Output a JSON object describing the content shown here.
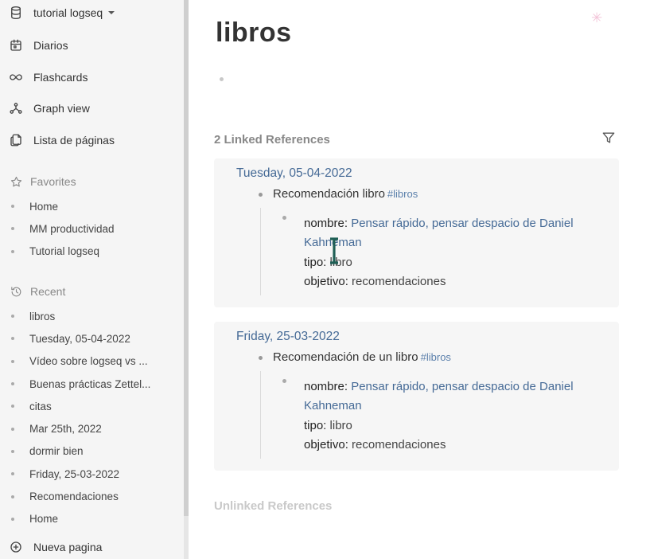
{
  "sidebar": {
    "graph_name": "tutorial logseq",
    "nav": [
      {
        "label": "Diarios",
        "icon": "calendar-icon"
      },
      {
        "label": "Flashcards",
        "icon": "infinity-icon"
      },
      {
        "label": "Graph view",
        "icon": "graph-icon"
      },
      {
        "label": "Lista de páginas",
        "icon": "pages-icon"
      }
    ],
    "favorites": {
      "title": "Favorites",
      "items": [
        "Home",
        "MM productividad",
        "Tutorial logseq"
      ]
    },
    "recent": {
      "title": "Recent",
      "items": [
        "libros",
        "Tuesday, 05-04-2022",
        "Vídeo sobre logseq vs ...",
        "Buenas prácticas Zettel...",
        "citas",
        "Mar 25th, 2022",
        "dormir bien",
        "Friday, 25-03-2022",
        "Recomendaciones",
        "Home"
      ]
    },
    "new_page": "Nueva pagina"
  },
  "page": {
    "title": "libros",
    "linked_title": "2 Linked References",
    "unlinked_title": "Unlinked References",
    "refs": [
      {
        "date": "Tuesday, 05-04-2022",
        "block": "Recomendación libro",
        "tag": "#libros",
        "props": {
          "nombre_key": "nombre:",
          "nombre_val": "Pensar rápido, pensar despacio de Daniel Kahneman",
          "tipo_key": "tipo:",
          "tipo_val": "libro",
          "objetivo_key": "objetivo:",
          "objetivo_val": "recomendaciones"
        }
      },
      {
        "date": "Friday, 25-03-2022",
        "block": "Recomendación de un libro",
        "tag": "#libros",
        "props": {
          "nombre_key": "nombre:",
          "nombre_val": "Pensar rápido, pensar despacio de Daniel Kahneman",
          "tipo_key": "tipo:",
          "tipo_val": "libro",
          "objetivo_key": "objetivo:",
          "objetivo_val": "recomendaciones"
        }
      }
    ]
  },
  "colors": {
    "link": "#456a96",
    "sidebar_bg": "#f5f5f5",
    "card_bg": "#f6f6f6"
  }
}
